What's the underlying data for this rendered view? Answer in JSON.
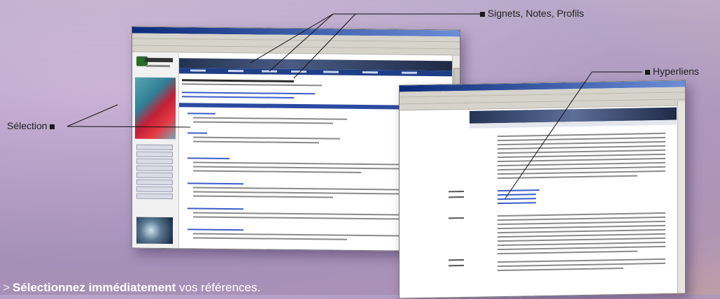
{
  "callouts": {
    "signets": "Signets, Notes, Profils",
    "hyperliens": "Hyperliens",
    "selection": "Sélection"
  },
  "bottom": {
    "arrow": ">",
    "bold": "Sélectionnez immédiatement",
    "rest": " vos références."
  },
  "colors": {
    "accent": "#1f3e86",
    "link": "#3c5cc9"
  }
}
